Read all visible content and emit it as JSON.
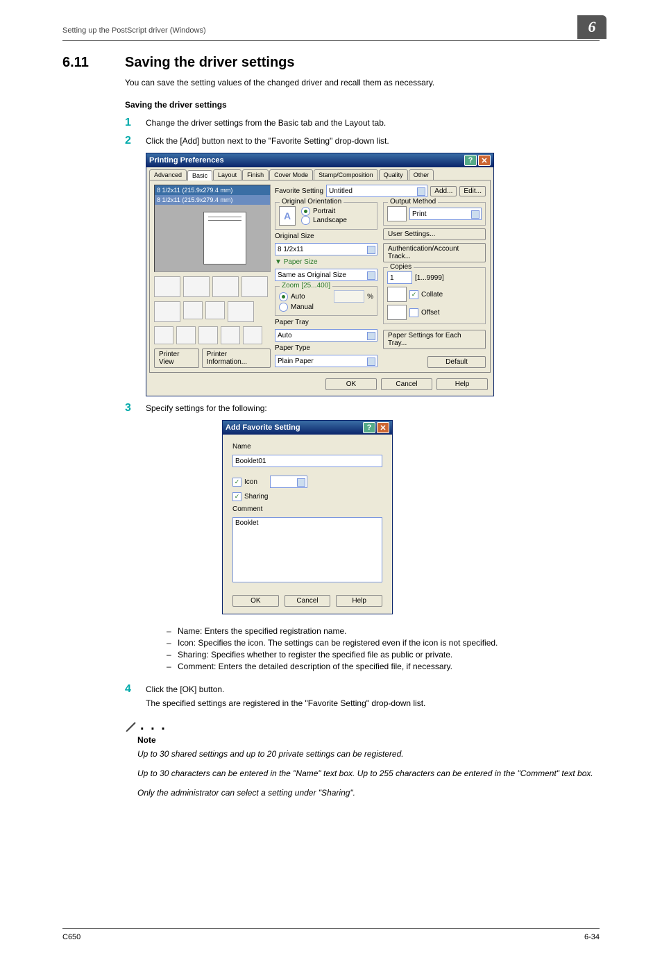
{
  "header": {
    "running_title": "Setting up the PostScript driver (Windows)",
    "page_badge": "6"
  },
  "footer": {
    "left": "C650",
    "right": "6-34"
  },
  "section": {
    "num": "6.11",
    "title": "Saving the driver settings",
    "intro": "You can save the setting values of the changed driver and recall them as necessary.",
    "subhead": "Saving the driver settings"
  },
  "steps": {
    "s1": "Change the driver settings from the Basic tab and the Layout tab.",
    "s2": "Click the [Add] button next to the \"Favorite Setting\" drop-down list.",
    "s3": "Specify settings for the following:",
    "s4": "Click the [OK] button.",
    "s4b": "The specified settings are registered in the \"Favorite Setting\" drop-down list."
  },
  "bullets": {
    "b1": "Name: Enters the specified registration name.",
    "b2": "Icon: Specifies the icon. The settings can be registered even if the icon is not specified.",
    "b3": "Sharing: Specifies whether to register the specified file as public or private.",
    "b4": "Comment: Enters the detailed description of the specified file, if necessary."
  },
  "note": {
    "head": "Note",
    "n1": "Up to 30 shared settings and up to 20 private settings can be registered.",
    "n2": "Up to 30 characters can be entered in the \"Name\" text box. Up to 255 characters can be entered in the \"Comment\" text box.",
    "n3": "Only the administrator can select a setting under \"Sharing\"."
  },
  "dlg1": {
    "title": "Printing Preferences",
    "tabs": [
      "Advanced",
      "Basic",
      "Layout",
      "Finish",
      "Cover Mode",
      "Stamp/Composition",
      "Quality",
      "Other"
    ],
    "active_tab": "Basic",
    "preview_bar1": "8 1/2x11 (215.9x279.4 mm)",
    "preview_bar2": "8 1/2x11 (215.9x279.4 mm)",
    "printer_view": "Printer View",
    "printer_info": "Printer Information...",
    "fav_label": "Favorite Setting",
    "fav_value": "Untitled",
    "add": "Add...",
    "edit": "Edit...",
    "orient_grp": "Original Orientation",
    "portrait": "Portrait",
    "landscape": "Landscape",
    "orig_size_lbl": "Original Size",
    "orig_size_val": "8 1/2x11",
    "paper_size_lbl": "Paper Size",
    "paper_size_val": "Same as Original Size",
    "zoom_grp": "Zoom [25...400]",
    "zoom_auto": "Auto",
    "zoom_manual": "Manual",
    "zoom_pct": "%",
    "tray_lbl": "Paper Tray",
    "tray_val": "Auto",
    "type_lbl": "Paper Type",
    "type_val": "Plain Paper",
    "out_grp": "Output Method",
    "out_val": "Print",
    "user_settings": "User Settings...",
    "auth": "Authentication/Account Track...",
    "copies_lbl": "Copies",
    "copies_val": "1",
    "copies_range": "[1...9999]",
    "collate": "Collate",
    "offset": "Offset",
    "paper_each_tray": "Paper Settings for Each Tray...",
    "default": "Default",
    "ok": "OK",
    "cancel": "Cancel",
    "help": "Help"
  },
  "dlg2": {
    "title": "Add Favorite Setting",
    "name_lbl": "Name",
    "name_val": "Booklet01",
    "icon_lbl": "Icon",
    "sharing_lbl": "Sharing",
    "comment_lbl": "Comment",
    "comment_val": "Booklet",
    "ok": "OK",
    "cancel": "Cancel",
    "help": "Help"
  }
}
